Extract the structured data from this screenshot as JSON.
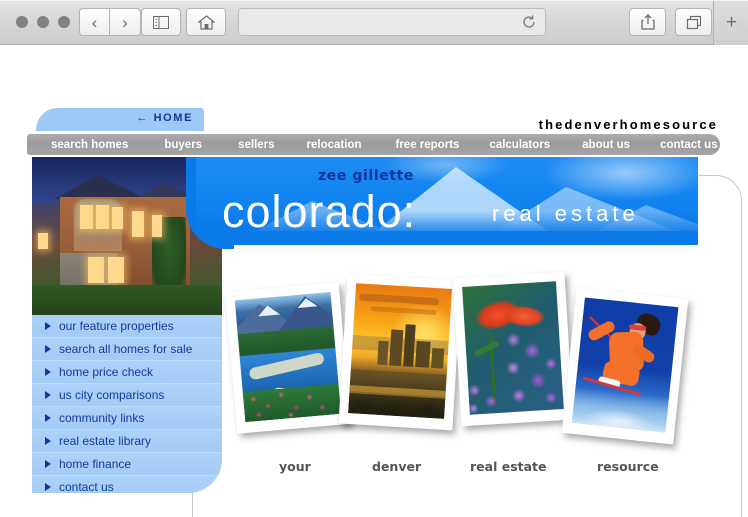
{
  "browser": {
    "traffic_lights": [
      "close",
      "minimize",
      "zoom"
    ],
    "back_icon": "chevron-left-icon",
    "forward_icon": "chevron-right-icon",
    "sidebar_icon": "sidebar-icon",
    "home_icon": "home-icon",
    "address_value": "",
    "address_placeholder": "",
    "reload_icon": "reload-icon",
    "share_icon": "share-icon",
    "tabs_icon": "tabs-icon",
    "new_tab_label": "+"
  },
  "page": {
    "home_tab": {
      "label": "← HOME"
    },
    "brand": "thedenverhomesource",
    "nav": {
      "items": [
        "search homes",
        "buyers",
        "sellers",
        "relocation",
        "free reports",
        "calculators",
        "about us",
        "contact us"
      ]
    },
    "banner": {
      "agent": "zee gillette",
      "title": "colorado:",
      "subtitle": "real estate",
      "background_image": "snowy-mountain-range-under-blue-sky",
      "accent_color": "#0b7ae9"
    },
    "feature_photo": {
      "alt": "luxury-home-at-dusk"
    },
    "sidebar": {
      "items": [
        "our feature properties",
        "search all homes for sale",
        "home price check",
        "us city comparisons",
        "community links",
        "real estate library",
        "home finance",
        "contact us"
      ],
      "bullet_icon": "triangle-right-icon",
      "background_color": "#a9cff7",
      "text_color": "#123a9e"
    },
    "photos": [
      {
        "caption": "your",
        "alt": "mountain-river-with-wildflowers"
      },
      {
        "caption": "denver",
        "alt": "denver-skyline-at-sunset"
      },
      {
        "caption": "real estate",
        "alt": "indian-paintbrush-and-lupine-wildflowers"
      },
      {
        "caption": "resource",
        "alt": "skier-in-orange-suit"
      }
    ]
  }
}
